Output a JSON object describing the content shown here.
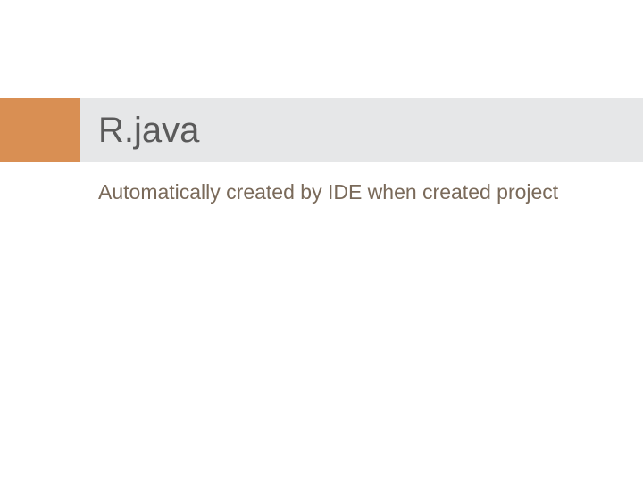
{
  "slide": {
    "title": "R.java",
    "body": "Automatically created by IDE when created project"
  }
}
